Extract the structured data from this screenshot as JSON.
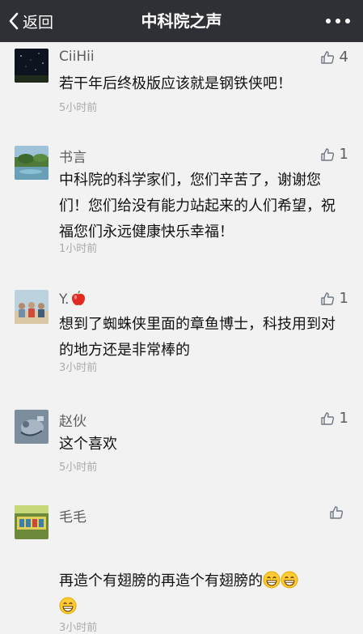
{
  "header": {
    "back_label": "返回",
    "title": "中科院之声",
    "back_icon": "chevron-left-icon",
    "more_icon": "more-dots-icon"
  },
  "comments": [
    {
      "nickname": "CiiHii",
      "likes": "4",
      "text": "若干年后终极版应该就是钢铁侠吧！",
      "time": "5小时前"
    },
    {
      "nickname": "书言",
      "likes": "1",
      "text": "中科院的科学家们，您们辛苦了，谢谢您们！您们给没有能力站起来的人们希望，祝福您们永远健康快乐幸福！",
      "time": "1小时前"
    },
    {
      "nickname": "Y.",
      "likes": "1",
      "text": "想到了蜘蛛侠里面的章鱼博士，科技用到对的地方还是非常棒的",
      "time": "3小时前"
    },
    {
      "nickname": "赵伙",
      "likes": "1",
      "text": "这个喜欢",
      "time": "5小时前"
    },
    {
      "nickname": "毛毛",
      "likes": "",
      "text": "再造个有翅膀的再造个有翅膀的",
      "time": "3小时前"
    }
  ],
  "icons": {
    "like": "thumbs-up-icon",
    "nickname_emoji": "apple-icon",
    "text_emoji": "grinning-face-icon"
  },
  "colors": {
    "header_bg": "#2f3035",
    "background": "#f2f2f2",
    "nickname": "#5d5d5d",
    "time": "#aaaaaa"
  }
}
